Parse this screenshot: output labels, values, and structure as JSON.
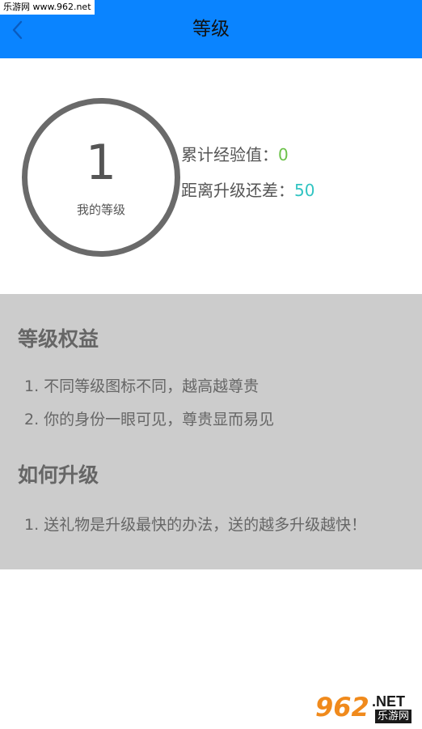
{
  "watermark": {
    "top_text": "乐游网 www.962.net",
    "bottom_number": "962",
    "bottom_net": ".NET",
    "bottom_site": "乐游网"
  },
  "header": {
    "title": "等级",
    "back_icon": "chevron-left-icon",
    "background": "#0a84ff"
  },
  "level": {
    "number": "1",
    "caption": "我的等级"
  },
  "stats": {
    "exp_label": "累计经验值：",
    "exp_value": "0",
    "exp_color": "#6cc24a",
    "diff_label": "距离升级还差：",
    "diff_value": "50",
    "diff_color": "#31c4c2"
  },
  "benefits": {
    "title": "等级权益",
    "items": [
      "1. 不同等级图标不同，越高越尊贵",
      "2. 你的身份一眼可见，尊贵显而易见"
    ]
  },
  "upgrade": {
    "title": "如何升级",
    "items": [
      "1. 送礼物是升级最快的办法，送的越多升级越快！"
    ]
  }
}
